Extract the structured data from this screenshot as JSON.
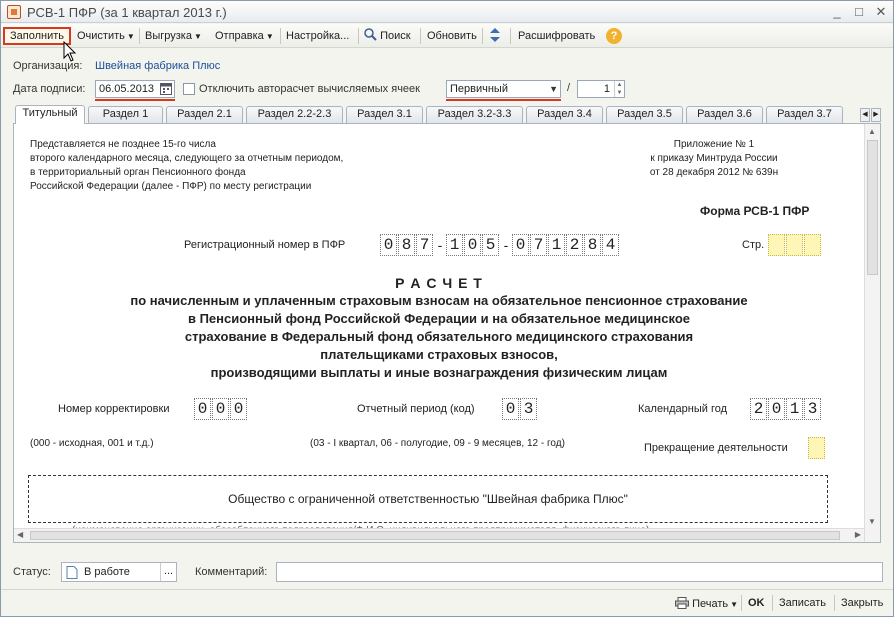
{
  "window": {
    "title": "РСВ-1 ПФР (за 1 квартал 2013 г.)",
    "minimize": "_",
    "maximize": "□",
    "close": "✕"
  },
  "toolbar": {
    "fill": "Заполнить",
    "clear": "Очистить",
    "export": "Выгрузка",
    "send": "Отправка",
    "settings": "Настройка...",
    "search": "Поиск",
    "refresh": "Обновить",
    "decode": "Расшифровать",
    "help": "?"
  },
  "org": {
    "label": "Организация:",
    "value": "Швейная фабрика Плюс"
  },
  "sign_date": {
    "label": "Дата подписи:",
    "value": "06.05.2013"
  },
  "autocalc": {
    "label": "Отключить авторасчет вычисляемых ячеек",
    "checked": false
  },
  "report_kind": {
    "value": "Первичный",
    "slash": "/",
    "number": "1"
  },
  "tabs": [
    "Титульный",
    "Раздел 1",
    "Раздел 2.1",
    "Раздел 2.2-2.3",
    "Раздел 3.1",
    "Раздел 3.2-3.3",
    "Раздел 3.4",
    "Раздел 3.5",
    "Раздел 3.6",
    "Раздел 3.7"
  ],
  "doc": {
    "left_note": [
      "Представляется не позднее 15-го числа",
      "второго календарного месяца, следующего за отчетным периодом,",
      "в территориальный орган Пенсионного фонда",
      "Российской Федерации (далее - ПФР) по месту регистрации"
    ],
    "right_note": [
      "Приложение № 1",
      "к приказу Минтруда России",
      "от 28 декабря 2012 № 639н"
    ],
    "form_title": "Форма РСВ-1 ПФР",
    "reg_label": "Регистрационный номер в ПФР",
    "reg_part1": [
      "0",
      "8",
      "7"
    ],
    "reg_part2": [
      "1",
      "0",
      "5"
    ],
    "reg_part3": [
      "0",
      "7",
      "1",
      "2",
      "8",
      "4"
    ],
    "page_label": "Стр.",
    "heading": [
      "Р А С Ч Е Т",
      "по начисленным и уплаченным страховым взносам на обязательное пенсионное страхование",
      "в Пенсионный фонд Российской Федерации и на обязательное медицинское",
      "страхование в Федеральный фонд обязательного медицинского страхования",
      "плательщиками страховых взносов,",
      "производящими выплаты и иные вознаграждения физическим лицам"
    ],
    "correction_label": "Номер корректировки",
    "correction": [
      "0",
      "0",
      "0"
    ],
    "correction_hint": "(000 - исходная, 001 и т.д.)",
    "period_label": "Отчетный период (код)",
    "period": [
      "0",
      "3"
    ],
    "period_hint": "(03 - I квартал, 06 - полугодие, 09 - 9 месяцев, 12 - год)",
    "year_label": "Календарный год",
    "year": [
      "2",
      "0",
      "1",
      "3"
    ],
    "stop_label": "Прекращение деятельности",
    "org_full": "Общество с ограниченной ответственностью \"Швейная фабрика Плюс\"",
    "org_caption": "(наименование организации, обособленного подразделения/Ф.И.О. индивидуального предпринимателя, физического лица)"
  },
  "status": {
    "label": "Статус:",
    "value": "В работе",
    "comment_label": "Комментарий:",
    "comment": ""
  },
  "bottom": {
    "print": "Печать",
    "ok": "OK",
    "save": "Записать",
    "close": "Закрыть"
  },
  "colors": {
    "highlight": "#d43a22",
    "link": "#1a4e9a",
    "cell_yellow": "#fdf6b6"
  }
}
